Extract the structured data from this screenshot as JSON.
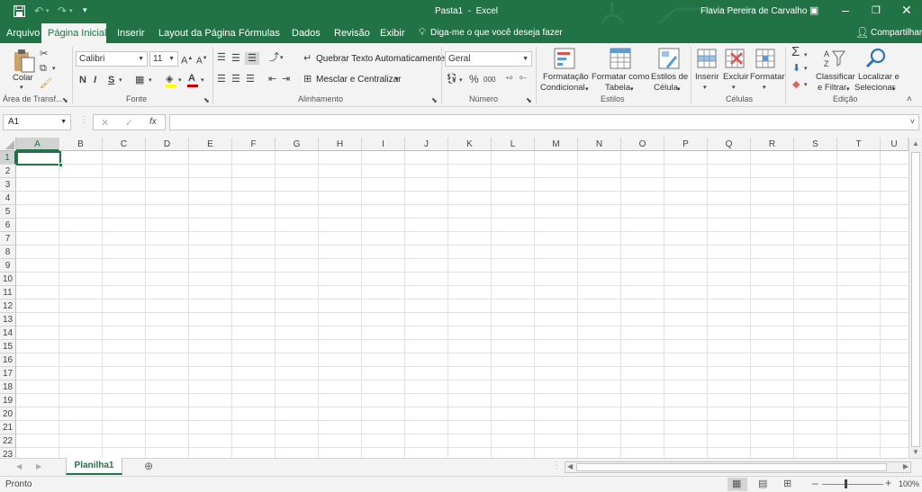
{
  "titlebar": {
    "doc_title": "Pasta1  -  Excel",
    "user_name": "Flavia Pereira de Carvalho",
    "save_icon": "save-icon",
    "undo_icon": "undo-icon",
    "redo_icon": "redo-icon",
    "accent": "#217346"
  },
  "tabs": [
    "Arquivo",
    "Página Inicial",
    "Inserir",
    "Layout da Página",
    "Fórmulas",
    "Dados",
    "Revisão",
    "Exibir"
  ],
  "tell_me": "Diga-me o que você deseja fazer",
  "share": "Compartilhar",
  "ribbon": {
    "clipboard": {
      "paste": "Colar",
      "label": "Área de Transf..."
    },
    "font": {
      "name": "Calibri",
      "size": "11",
      "bold": "N",
      "italic": "I",
      "underline": "S",
      "label": "Fonte"
    },
    "alignment": {
      "wrap": "Quebrar Texto Automaticamente",
      "merge": "Mesclar e Centralizar",
      "label": "Alinhamento"
    },
    "number": {
      "format": "Geral",
      "percent": "%",
      "thousands": "000",
      "label": "Número"
    },
    "styles": {
      "conditional_1": "Formatação",
      "conditional_2": "Condicional",
      "table_1": "Formatar como",
      "table_2": "Tabela",
      "cell_1": "Estilos de",
      "cell_2": "Célula",
      "label": "Estilos"
    },
    "cells": {
      "insert": "Inserir",
      "delete": "Excluir",
      "format": "Formatar",
      "label": "Células"
    },
    "editing": {
      "sort_1": "Classificar",
      "sort_2": "e Filtrar",
      "find_1": "Localizar e",
      "find_2": "Selecionar",
      "label": "Edição"
    }
  },
  "formula_bar": {
    "name_box": "A1",
    "fx": "fx",
    "cancel": "✕",
    "enter": "✓",
    "content": ""
  },
  "columns": [
    "A",
    "B",
    "C",
    "D",
    "E",
    "F",
    "G",
    "H",
    "I",
    "J",
    "K",
    "L",
    "M",
    "N",
    "O",
    "P",
    "Q",
    "R",
    "S",
    "T",
    "U"
  ],
  "rows": [
    "1",
    "2",
    "3",
    "4",
    "5",
    "6",
    "7",
    "8",
    "9",
    "10",
    "11",
    "12",
    "13",
    "14",
    "15",
    "16",
    "17",
    "18",
    "19",
    "20",
    "21",
    "22",
    "23"
  ],
  "sheet_tab": "Planilha1",
  "status": {
    "ready": "Pronto",
    "zoom": "100%"
  }
}
